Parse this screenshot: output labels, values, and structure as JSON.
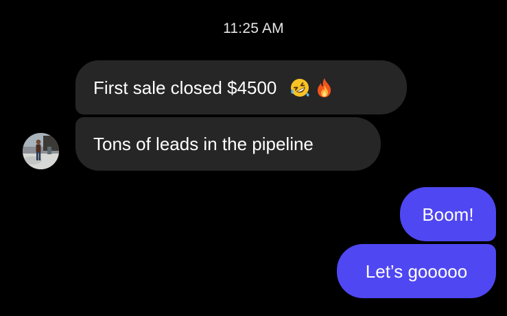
{
  "thread": {
    "timestamp": "11:25 AM",
    "incoming": [
      {
        "text": "First sale closed $4500",
        "emojis": [
          "rolling-on-floor-laughing-emoji",
          "fire-emoji"
        ]
      },
      {
        "text": "Tons of leads in the pipeline"
      }
    ],
    "outgoing": [
      {
        "text": "Boom!"
      },
      {
        "text": "Let’s gooooo"
      }
    ]
  },
  "colors": {
    "background": "#000000",
    "incoming_bubble": "#262626",
    "outgoing_bubble": "#4f47f2",
    "text": "#ffffff"
  },
  "icons": {
    "avatar": "contact-avatar-photo"
  }
}
